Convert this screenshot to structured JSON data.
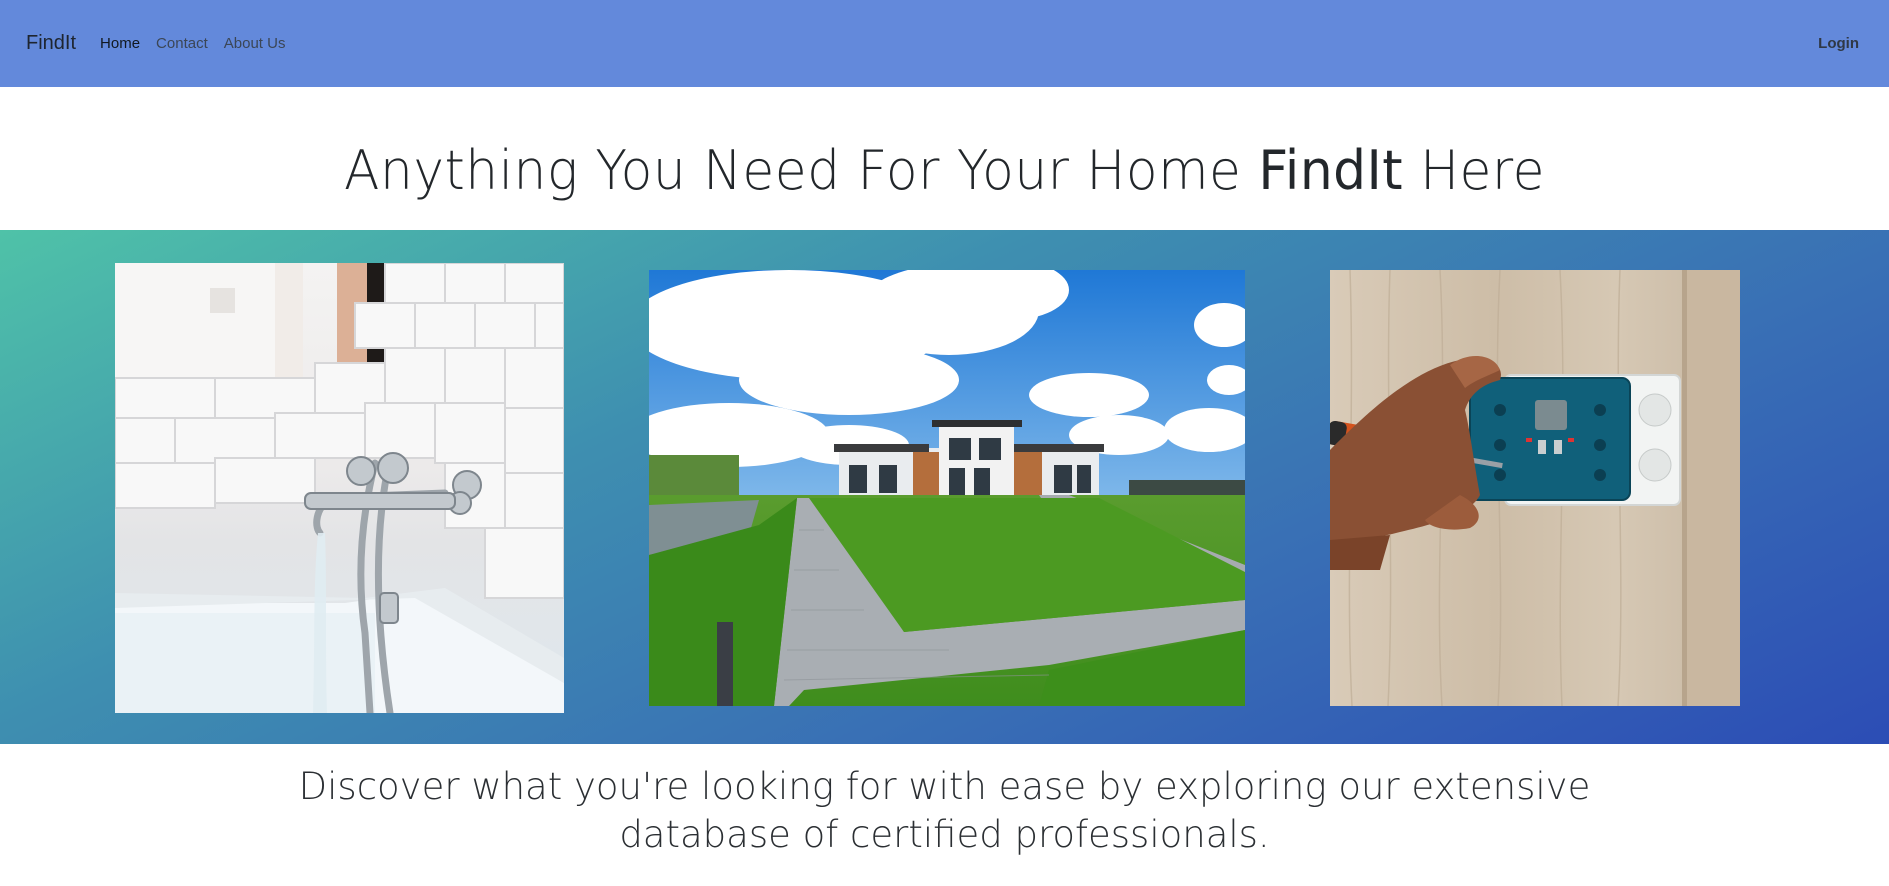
{
  "nav": {
    "brand": "FindIt",
    "links": [
      "Home",
      "Contact",
      "About Us"
    ],
    "login": "Login"
  },
  "headline": {
    "before": "Anything You Need For Your Home ",
    "brand": "FindIt",
    "after": " Here"
  },
  "gallery": {
    "images": [
      "bathtub-faucet-photo",
      "modern-house-lawn-photo",
      "electrician-socket-photo"
    ]
  },
  "tagline": {
    "line1": "Discover what you're looking for with ease by exploring our extensive",
    "line2": "database of certified professionals."
  },
  "colors": {
    "navbar": "#6389db",
    "gradient_start": "#4fc2a8",
    "gradient_end": "#2c4db5"
  }
}
